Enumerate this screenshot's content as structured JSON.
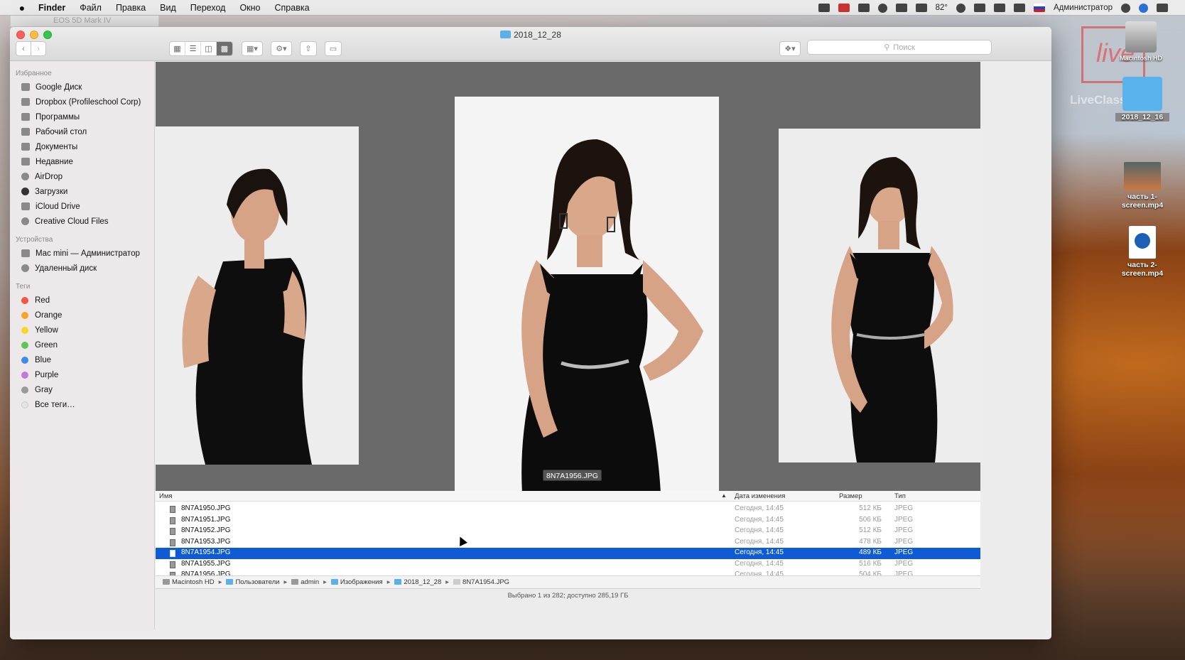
{
  "menubar": {
    "app": "Finder",
    "items": [
      "Файл",
      "Правка",
      "Вид",
      "Переход",
      "Окно",
      "Справка"
    ],
    "temperature": "82°",
    "user": "Администратор"
  },
  "background_tab": "EOS 5D Mark IV",
  "window": {
    "title": "2018_12_28",
    "search_placeholder": "Поиск"
  },
  "sidebar": {
    "favorites_header": "Избранное",
    "favorites": [
      {
        "label": "Google Диск",
        "icon": "google-drive-icon"
      },
      {
        "label": "Dropbox (Profileschool Corp)",
        "icon": "dropbox-icon"
      },
      {
        "label": "Программы",
        "icon": "applications-icon"
      },
      {
        "label": "Рабочий стол",
        "icon": "desktop-icon"
      },
      {
        "label": "Документы",
        "icon": "documents-icon"
      },
      {
        "label": "Недавние",
        "icon": "recents-icon"
      },
      {
        "label": "AirDrop",
        "icon": "airdrop-icon"
      },
      {
        "label": "Загрузки",
        "icon": "downloads-icon"
      },
      {
        "label": "iCloud Drive",
        "icon": "icloud-icon"
      },
      {
        "label": "Creative Cloud Files",
        "icon": "creative-cloud-icon"
      }
    ],
    "devices_header": "Устройства",
    "devices": [
      {
        "label": "Mac mini — Администратор",
        "icon": "computer-icon"
      },
      {
        "label": "Удаленный диск",
        "icon": "disc-icon"
      }
    ],
    "tags_header": "Теги",
    "tags": [
      {
        "label": "Red",
        "color": "#f0573f"
      },
      {
        "label": "Orange",
        "color": "#f5a623"
      },
      {
        "label": "Yellow",
        "color": "#f8d72c"
      },
      {
        "label": "Green",
        "color": "#5dc45a"
      },
      {
        "label": "Blue",
        "color": "#3b8ee8"
      },
      {
        "label": "Purple",
        "color": "#c17ad7"
      },
      {
        "label": "Gray",
        "color": "#9a9a9a"
      },
      {
        "label": "Все теги…",
        "color": "#e4e4e4"
      }
    ]
  },
  "coverflow": {
    "selected_label": "8N7A1956.JPG"
  },
  "list": {
    "headers": {
      "name": "Имя",
      "date": "Дата изменения",
      "size": "Размер",
      "type": "Тип"
    },
    "rows": [
      {
        "name": "8N7A1950.JPG",
        "date": "Сегодня, 14:45",
        "size": "512 КБ",
        "type": "JPEG",
        "selected": false
      },
      {
        "name": "8N7A1951.JPG",
        "date": "Сегодня, 14:45",
        "size": "506 КБ",
        "type": "JPEG",
        "selected": false
      },
      {
        "name": "8N7A1952.JPG",
        "date": "Сегодня, 14:45",
        "size": "512 КБ",
        "type": "JPEG",
        "selected": false
      },
      {
        "name": "8N7A1953.JPG",
        "date": "Сегодня, 14:45",
        "size": "478 КБ",
        "type": "JPEG",
        "selected": false
      },
      {
        "name": "8N7A1954.JPG",
        "date": "Сегодня, 14:45",
        "size": "489 КБ",
        "type": "JPEG",
        "selected": true
      },
      {
        "name": "8N7A1955.JPG",
        "date": "Сегодня, 14:45",
        "size": "516 КБ",
        "type": "JPEG",
        "selected": false
      },
      {
        "name": "8N7A1956.JPG",
        "date": "Сегодня, 14:45",
        "size": "504 КБ",
        "type": "JPEG",
        "selected": false
      }
    ]
  },
  "pathbar": [
    "Macintosh HD",
    "Пользователи",
    "admin",
    "Изображения",
    "2018_12_28",
    "8N7A1954.JPG"
  ],
  "status": "Выбрано 1 из 282; доступно 285,19 ГБ",
  "desktop": {
    "hd_label": "Macintosh HD",
    "folder_label": "2018_12_16",
    "file1_label": "часть 1-screen.mp4",
    "file2_label": "часть 2-screen.mp4",
    "watermark": "live",
    "watermark_text": "LiveClasses.ru"
  }
}
